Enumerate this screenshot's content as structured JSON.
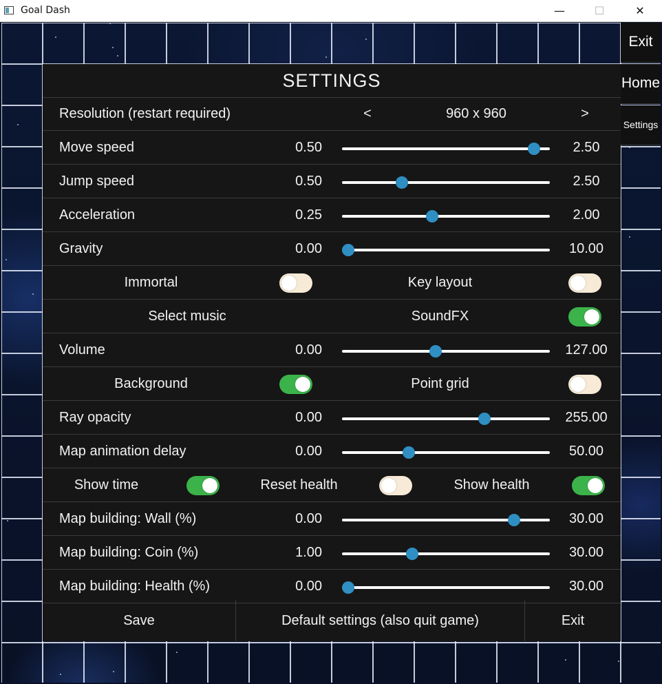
{
  "window": {
    "title": "Goal Dash",
    "minimize": "—",
    "maximize": "☐",
    "close": "✕"
  },
  "nav": {
    "exit": "Exit",
    "home": "Home",
    "settings": "Settings"
  },
  "settings": {
    "title": "SETTINGS",
    "resolution": {
      "label": "Resolution (restart required)",
      "prev": "<",
      "value": "960 x 960",
      "next": ">"
    },
    "sliders": [
      {
        "id": "move_speed",
        "label": "Move speed",
        "min": "0.50",
        "max": "2.50",
        "value": 2.4
      },
      {
        "id": "jump_speed",
        "label": "Jump speed",
        "min": "0.50",
        "max": "2.50",
        "value": 1.05
      },
      {
        "id": "acceleration",
        "label": "Acceleration",
        "min": "0.25",
        "max": "2.00",
        "value": 1.0
      },
      {
        "id": "gravity",
        "label": "Gravity",
        "min": "0.00",
        "max": "10.00",
        "value": 0.0
      },
      {
        "id": "volume",
        "label": "Volume",
        "min": "0.00",
        "max": "127.00",
        "value": 57
      },
      {
        "id": "ray_opacity",
        "label": "Ray opacity",
        "min": "0.00",
        "max": "255.00",
        "value": 178
      },
      {
        "id": "map_animation_delay",
        "label": "Map animation delay",
        "min": "0.00",
        "max": "50.00",
        "value": 15.5
      },
      {
        "id": "wall",
        "label": "Map building: Wall (%)",
        "min": "0.00",
        "max": "30.00",
        "value": 25.5
      },
      {
        "id": "coin",
        "label": "Map building: Coin (%)",
        "min": "1.00",
        "max": "30.00",
        "value": 10.5
      },
      {
        "id": "health",
        "label": "Map building: Health (%)",
        "min": "0.00",
        "max": "30.00",
        "value": 0.0
      }
    ],
    "toggles": {
      "immortal": {
        "label": "Immortal",
        "on": false
      },
      "key_layout": {
        "label": "Key layout",
        "on": false
      },
      "sound_fx": {
        "label": "SoundFX",
        "on": true
      },
      "background": {
        "label": "Background",
        "on": true
      },
      "point_grid": {
        "label": "Point grid",
        "on": false
      },
      "show_time": {
        "label": "Show time",
        "on": true
      },
      "reset_health": {
        "label": "Reset health",
        "on": false
      },
      "show_health": {
        "label": "Show health",
        "on": true
      }
    },
    "select_music": "Select music",
    "buttons": {
      "save": "Save",
      "default": "Default settings (also quit game)",
      "exit": "Exit"
    }
  },
  "colors": {
    "panel": "#161616",
    "slider_thumb": "#2f8fc2",
    "toggle_on": "#3bb34a",
    "toggle_off": "#f7ead6"
  }
}
